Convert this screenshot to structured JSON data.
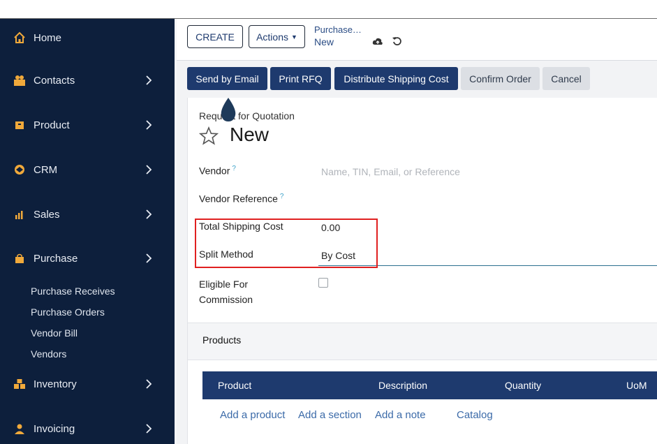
{
  "sidebar": {
    "items": [
      {
        "label": "Home"
      },
      {
        "label": "Contacts"
      },
      {
        "label": "Product"
      },
      {
        "label": "CRM"
      },
      {
        "label": "Sales"
      },
      {
        "label": "Purchase"
      },
      {
        "label": "Inventory"
      },
      {
        "label": "Invoicing"
      }
    ],
    "purchase_sub": [
      "Purchase Receives",
      "Purchase Orders",
      "Vendor Bill",
      "Vendors"
    ]
  },
  "control": {
    "create_label": "CREATE",
    "actions_label": "Actions",
    "breadcrumb_parent": "Purchase…",
    "breadcrumb_current": "New"
  },
  "status_buttons": {
    "send_email": "Send by Email",
    "print_rfq": "Print RFQ",
    "distribute": "Distribute Shipping Cost",
    "confirm": "Confirm Order",
    "cancel": "Cancel"
  },
  "form": {
    "subtitle": "Request for Quotation",
    "title": "New",
    "vendor_label": "Vendor",
    "vendor_placeholder": "Name, TIN, Email, or Reference",
    "vendor_ref_label": "Vendor Reference",
    "help_mark": "?",
    "shipping_label": "Total Shipping Cost",
    "shipping_value": "0.00",
    "split_label": "Split Method",
    "split_value": "By Cost",
    "eligible_label_1": "Eligible For",
    "eligible_label_2": "Commission",
    "eligible_checked": false
  },
  "products": {
    "tab_label": "Products",
    "columns": [
      "Product",
      "Description",
      "Quantity",
      "UoM"
    ],
    "add_product": "Add a product",
    "add_section": "Add a section",
    "add_note": "Add a note",
    "catalog": "Catalog"
  },
  "colors": {
    "sidebar_bg": "#0d1f3c",
    "primary": "#1e3a6e",
    "icon_accent": "#f0a93b",
    "highlight_box": "#e02020"
  }
}
